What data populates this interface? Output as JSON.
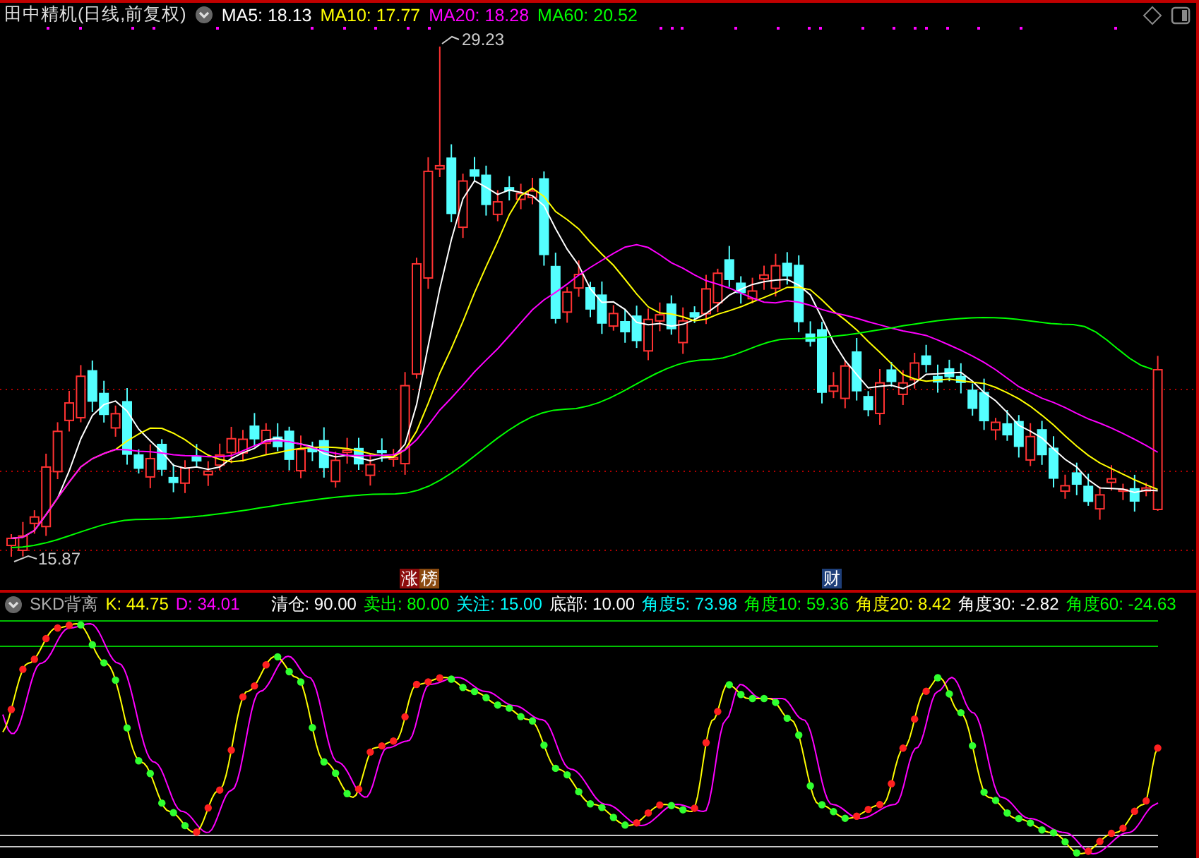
{
  "title": "田中精机(日线,前复权)",
  "ma_legend": [
    {
      "label": "MA5: 18.13",
      "color": "#ffffff"
    },
    {
      "label": "MA10: 17.77",
      "color": "#ffff00"
    },
    {
      "label": "MA20: 18.28",
      "color": "#ff00ff"
    },
    {
      "label": "MA60: 20.52",
      "color": "#00ff00"
    }
  ],
  "price_chart": {
    "high_label": "29.23",
    "low_label": "15.87"
  },
  "event_badges": [
    {
      "text": "涨",
      "color": "#8c0c0c"
    },
    {
      "text": "榜",
      "color": "#8a4a10"
    },
    {
      "text": "财",
      "color": "#1e3f7a"
    }
  ],
  "indicator": {
    "name": "SKD背离",
    "values": [
      {
        "label": "K: 44.75",
        "color": "#ffff00"
      },
      {
        "label": "D: 34.01",
        "color": "#ff00ff"
      }
    ],
    "levels": [
      {
        "label": "清仓: 90.00",
        "color": "#ffffff"
      },
      {
        "label": "卖出: 80.00",
        "color": "#00ff00"
      },
      {
        "label": "关注: 15.00",
        "color": "#00ffff"
      },
      {
        "label": "底部: 10.00",
        "color": "#ffffff"
      },
      {
        "label": "角度5: 73.98",
        "color": "#00ffff"
      },
      {
        "label": "角度10: 59.36",
        "color": "#00ff00"
      },
      {
        "label": "角度20: 8.42",
        "color": "#ffff00"
      },
      {
        "label": "角度30: -2.82",
        "color": "#ffffff"
      },
      {
        "label": "角度60: -24.63",
        "color": "#00ff00"
      }
    ]
  }
}
